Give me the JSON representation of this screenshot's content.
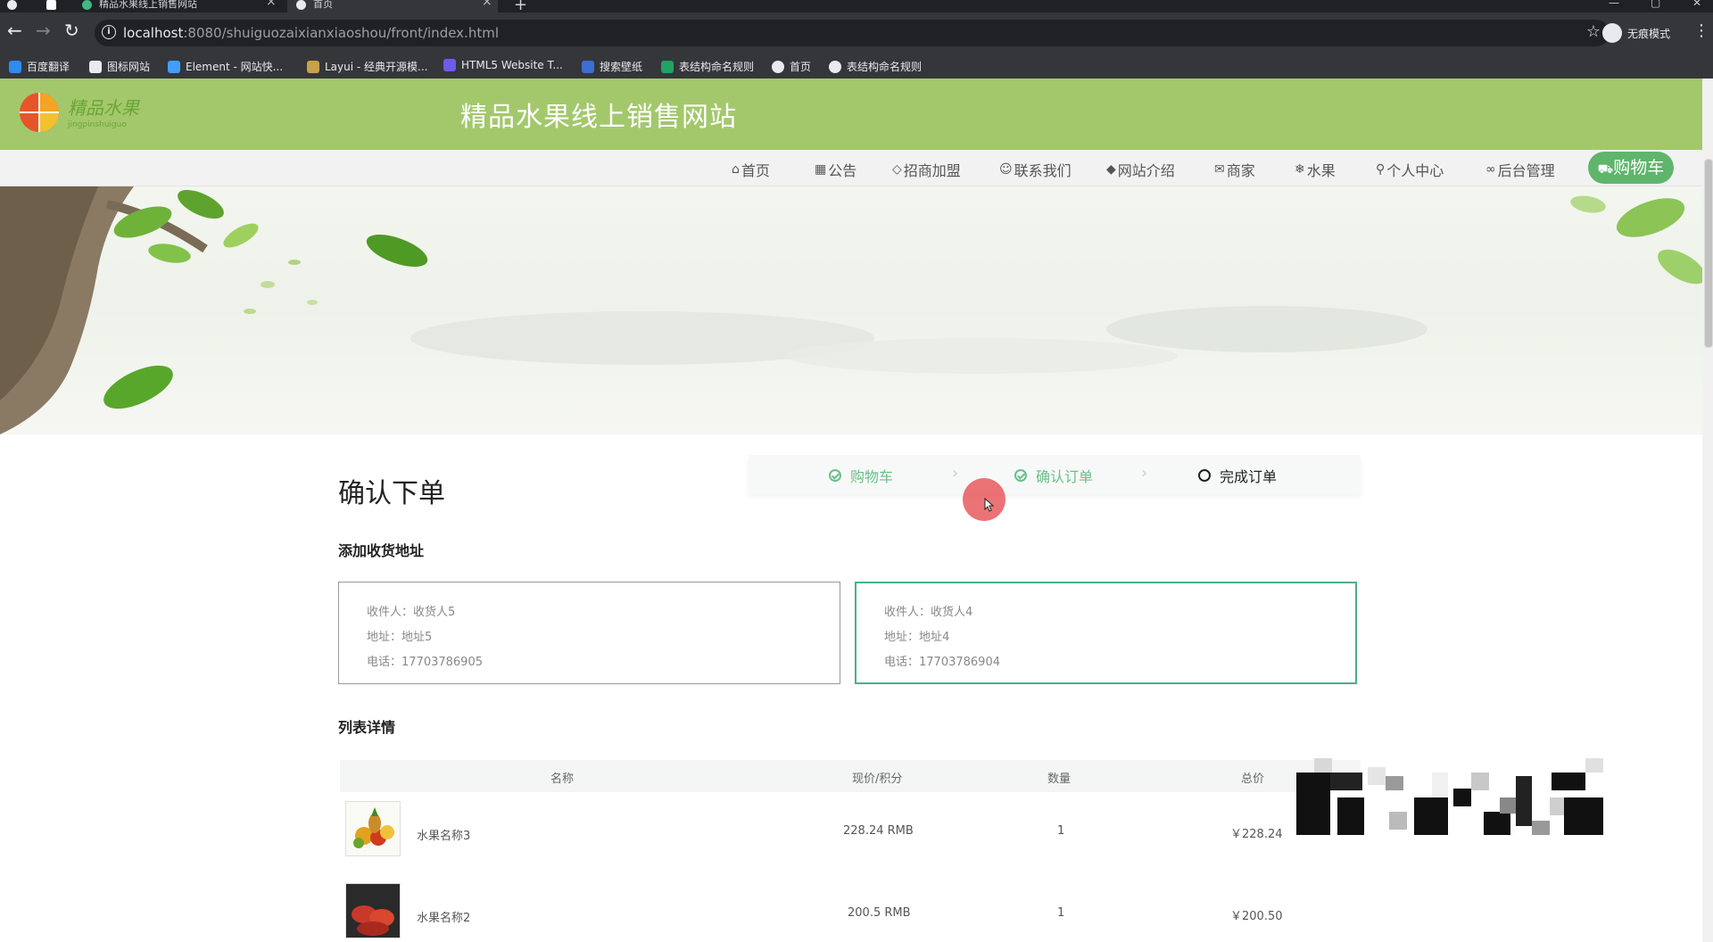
{
  "browser": {
    "tabs": [
      {
        "title": "精品水果线上销售网站",
        "active": false
      },
      {
        "title": "首页",
        "active": true
      }
    ],
    "url_host": "localhost",
    "url_rest": ":8080/shuiguozaixianxiaoshou/front/index.html",
    "incognito_label": "无痕模式",
    "bookmarks": [
      "百度翻译",
      "图标网站",
      "Element - 网站快...",
      "Layui - 经典开源模...",
      "HTML5 Website T...",
      "搜索壁纸",
      "表结构命名规则",
      "首页",
      "表结构命名规则"
    ]
  },
  "site": {
    "title": "精品水果线上销售网站",
    "logo_text": "精品水果",
    "logo_sub": "jingpinshuiguo",
    "nav": [
      "首页",
      "公告",
      "招商加盟",
      "联系我们",
      "网站介绍",
      "商家",
      "水果",
      "个人中心",
      "后台管理"
    ],
    "cart_label": "购物车"
  },
  "order": {
    "heading": "确认下单",
    "steps": [
      {
        "label": "购物车",
        "done": true
      },
      {
        "label": "确认订单",
        "done": true
      },
      {
        "label": "完成订单",
        "done": false
      }
    ],
    "address_section": "添加收货地址",
    "addresses": [
      {
        "receiver": "收件人：收货人5",
        "address": "地址：地址5",
        "phone": "电话：17703786905",
        "selected": false
      },
      {
        "receiver": "收件人：收货人4",
        "address": "地址：地址4",
        "phone": "电话：17703786904",
        "selected": true
      }
    ],
    "list_section": "列表详情",
    "columns": [
      "名称",
      "现价/积分",
      "数量",
      "总价"
    ],
    "items": [
      {
        "name": "水果名称3",
        "price": "228.24 RMB",
        "qty": "1",
        "total": "￥228.24"
      },
      {
        "name": "水果名称2",
        "price": "200.5 RMB",
        "qty": "1",
        "total": "￥200.50"
      }
    ]
  },
  "colors": {
    "header_green": "#a3c86c",
    "cart_green": "#5fb56b",
    "step_done": "#6abf8a",
    "selected_border": "#4caf86",
    "cursor_highlight": "#e74c4e"
  }
}
